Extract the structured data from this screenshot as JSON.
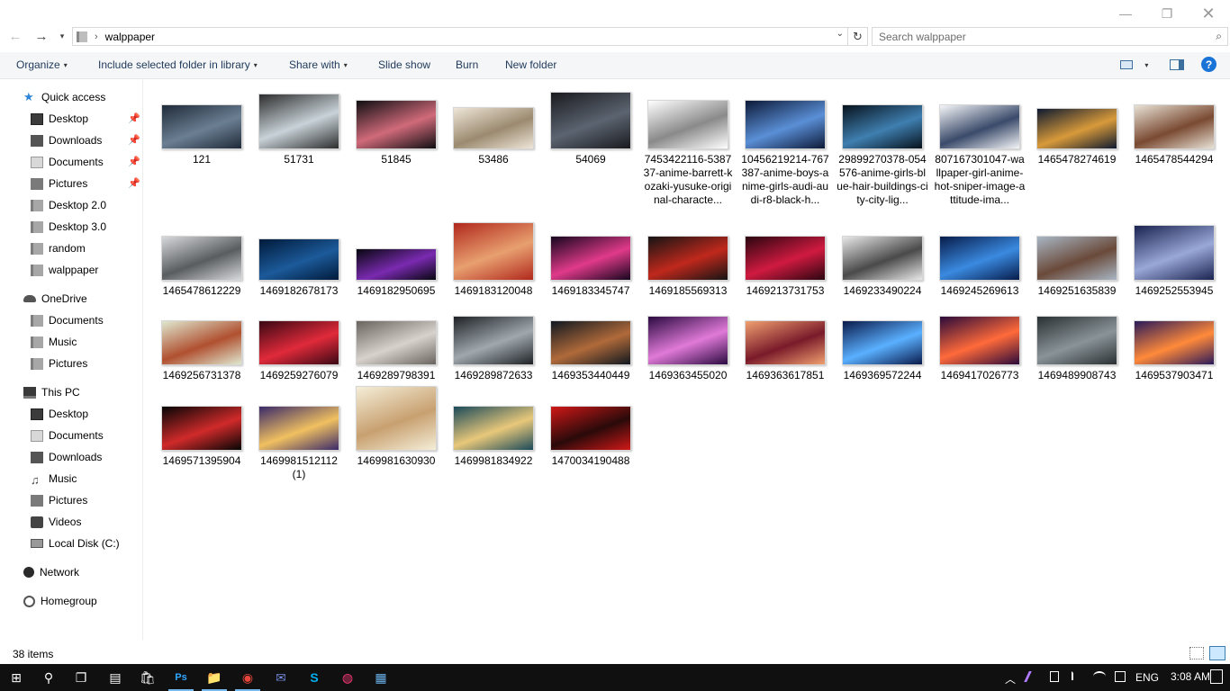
{
  "window": {
    "minimize_glyph": "—",
    "maximize_glyph": "❐",
    "close_glyph": "✕"
  },
  "address": {
    "back_glyph": "←",
    "forward_glyph": "→",
    "recent_glyph": "▾",
    "separator": "›",
    "path": "walppaper",
    "dropdown_glyph": "⌄",
    "refresh_glyph": "↻"
  },
  "search": {
    "placeholder": "Search walppaper",
    "icon_glyph": "⌕"
  },
  "toolbar": {
    "organize": "Organize",
    "include_library": "Include selected folder in library",
    "share_with": "Share with",
    "slide_show": "Slide show",
    "burn": "Burn",
    "new_folder": "New folder",
    "caret": "▾",
    "help": "?"
  },
  "nav": {
    "pin_glyph": "📌",
    "quick_access": "Quick access",
    "quick_items": [
      "Desktop",
      "Downloads",
      "Documents",
      "Pictures",
      "Desktop 2.0",
      "Desktop 3.0",
      "random",
      "walppaper"
    ],
    "onedrive": "OneDrive",
    "onedrive_items": [
      "Documents",
      "Music",
      "Pictures"
    ],
    "this_pc": "This PC",
    "pc_items": [
      "Desktop",
      "Documents",
      "Downloads",
      "Music",
      "Pictures",
      "Videos",
      "Local Disk (C:)"
    ],
    "network": "Network",
    "homegroup": "Homegroup",
    "music_glyph": "♫"
  },
  "files": [
    {
      "name": "121",
      "colors": [
        "#1f2a38",
        "#6b7f93"
      ]
    },
    {
      "name": "51731",
      "colors": [
        "#2d2d2d",
        "#c8d2d8"
      ]
    },
    {
      "name": "51845",
      "colors": [
        "#0f0f12",
        "#d06a7a"
      ]
    },
    {
      "name": "53486",
      "colors": [
        "#efe6d8",
        "#9b8a70"
      ]
    },
    {
      "name": "54069",
      "colors": [
        "#1a1a1f",
        "#5b6470"
      ]
    },
    {
      "name": "7453422116-538737-anime-barrett-kozaki-yusuke-original-characte...",
      "colors": [
        "#ffffff",
        "#8a8a8a"
      ]
    },
    {
      "name": "10456219214-767387-anime-boys-anime-girls-audi-audi-r8-black-h...",
      "colors": [
        "#0d1a38",
        "#5a8fd6"
      ]
    },
    {
      "name": "29899270378-054576-anime-girls-blue-hair-buildings-city-city-lig...",
      "colors": [
        "#07121c",
        "#3f7fb0"
      ]
    },
    {
      "name": "807167301047-wallpaper-girl-anime-hot-sniper-image-attitude-ima...",
      "colors": [
        "#f5f6f8",
        "#3a4a6a"
      ]
    },
    {
      "name": "1465478274619",
      "colors": [
        "#0e1a30",
        "#d89a3a"
      ]
    },
    {
      "name": "1465478544294",
      "colors": [
        "#e8e2d6",
        "#7a4a32"
      ]
    },
    {
      "name": "1465478612229",
      "colors": [
        "#d7d9dc",
        "#5a5d60"
      ]
    },
    {
      "name": "1469182678173",
      "colors": [
        "#001a3a",
        "#1c5a9a"
      ]
    },
    {
      "name": "1469182950695",
      "colors": [
        "#07070f",
        "#7a2ab0"
      ]
    },
    {
      "name": "1469183120048",
      "colors": [
        "#b0281c",
        "#e8a070"
      ]
    },
    {
      "name": "1469183345747",
      "colors": [
        "#15061e",
        "#e03a8a"
      ]
    },
    {
      "name": "1469185569313",
      "colors": [
        "#141414",
        "#c0281c"
      ]
    },
    {
      "name": "1469213731753",
      "colors": [
        "#2a0610",
        "#d01a40"
      ]
    },
    {
      "name": "1469233490224",
      "colors": [
        "#e8e8e8",
        "#4a4a4a"
      ]
    },
    {
      "name": "1469245269613",
      "colors": [
        "#071c4a",
        "#3a8ae0"
      ]
    },
    {
      "name": "1469251635839",
      "colors": [
        "#a8b6c4",
        "#6a4a3a"
      ]
    },
    {
      "name": "1469252553945",
      "colors": [
        "#1a2350",
        "#9aa8d8"
      ]
    },
    {
      "name": "1469256731378",
      "colors": [
        "#dfe8d0",
        "#b05030"
      ]
    },
    {
      "name": "1469259276079",
      "colors": [
        "#3a0814",
        "#e02a3a"
      ]
    },
    {
      "name": "1469289798391",
      "colors": [
        "#6a6460",
        "#d8d2cc"
      ]
    },
    {
      "name": "1469289872633",
      "colors": [
        "#1e2226",
        "#a0a8ae"
      ]
    },
    {
      "name": "1469353440449",
      "colors": [
        "#101820",
        "#b06a3a"
      ]
    },
    {
      "name": "1469363455020",
      "colors": [
        "#2a0a40",
        "#e07ad8"
      ]
    },
    {
      "name": "1469363617851",
      "colors": [
        "#f0a070",
        "#7a1a2a"
      ]
    },
    {
      "name": "1469369572244",
      "colors": [
        "#0a1a4a",
        "#5ab0ff"
      ]
    },
    {
      "name": "1469417026773",
      "colors": [
        "#2a0a3a",
        "#ff6a3a"
      ]
    },
    {
      "name": "1469489908743",
      "colors": [
        "#2a3034",
        "#8a9498"
      ]
    },
    {
      "name": "1469537903471",
      "colors": [
        "#2a1a5a",
        "#ff8a3a"
      ]
    },
    {
      "name": "1469571395904",
      "colors": [
        "#050505",
        "#d02a2a"
      ]
    },
    {
      "name": "1469981512112 (1)",
      "colors": [
        "#3a2a6a",
        "#f0c060"
      ]
    },
    {
      "name": "1469981630930",
      "colors": [
        "#f4eed8",
        "#c8a070"
      ]
    },
    {
      "name": "1469981834922",
      "colors": [
        "#1a4a5a",
        "#e8c87a"
      ]
    },
    {
      "name": "1470034190488",
      "colors": [
        "#d01818",
        "#2a0a0a"
      ]
    }
  ],
  "status": {
    "item_count": "38 items"
  },
  "taskbar": {
    "start_glyph": "⊞",
    "search_glyph": "⚲",
    "taskview_glyph": "❐",
    "apps": [
      "▤",
      "🛍",
      "Ps",
      "📁",
      "◉",
      "✉",
      "S",
      "◍",
      "▦"
    ],
    "tray_up": "︿",
    "language": "ENG",
    "time": "3:08 AM"
  }
}
